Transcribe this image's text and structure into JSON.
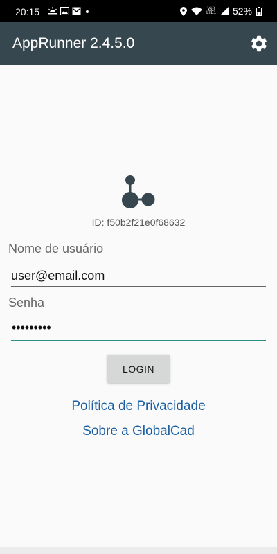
{
  "status_bar": {
    "time": "20:15",
    "signal_text_top": "Vo))",
    "signal_text_bottom": "LTE1",
    "battery": "52%",
    "icons": [
      "weather-icon",
      "image-icon",
      "mail-icon",
      "dot-icon",
      "location-icon",
      "wifi-icon",
      "signal-icon",
      "battery-icon"
    ]
  },
  "app_bar": {
    "title": "AppRunner 2.4.5.0",
    "settings_icon": "gear-icon",
    "background": "#36474f"
  },
  "logo": {
    "icon": "share-nodes-icon",
    "color": "#36474f"
  },
  "device_id": "ID: f50b2f21e0f68632",
  "form": {
    "username_label": "Nome de usuário",
    "username_value": "user@email.com",
    "password_label": "Senha",
    "password_mask": "•••••••••",
    "login_button": "LOGIN",
    "accent_color": "#2a8f86"
  },
  "links": {
    "privacy": "Política de Privacidade",
    "about": "Sobre a GlobalCad",
    "color": "#1a5fa3"
  }
}
